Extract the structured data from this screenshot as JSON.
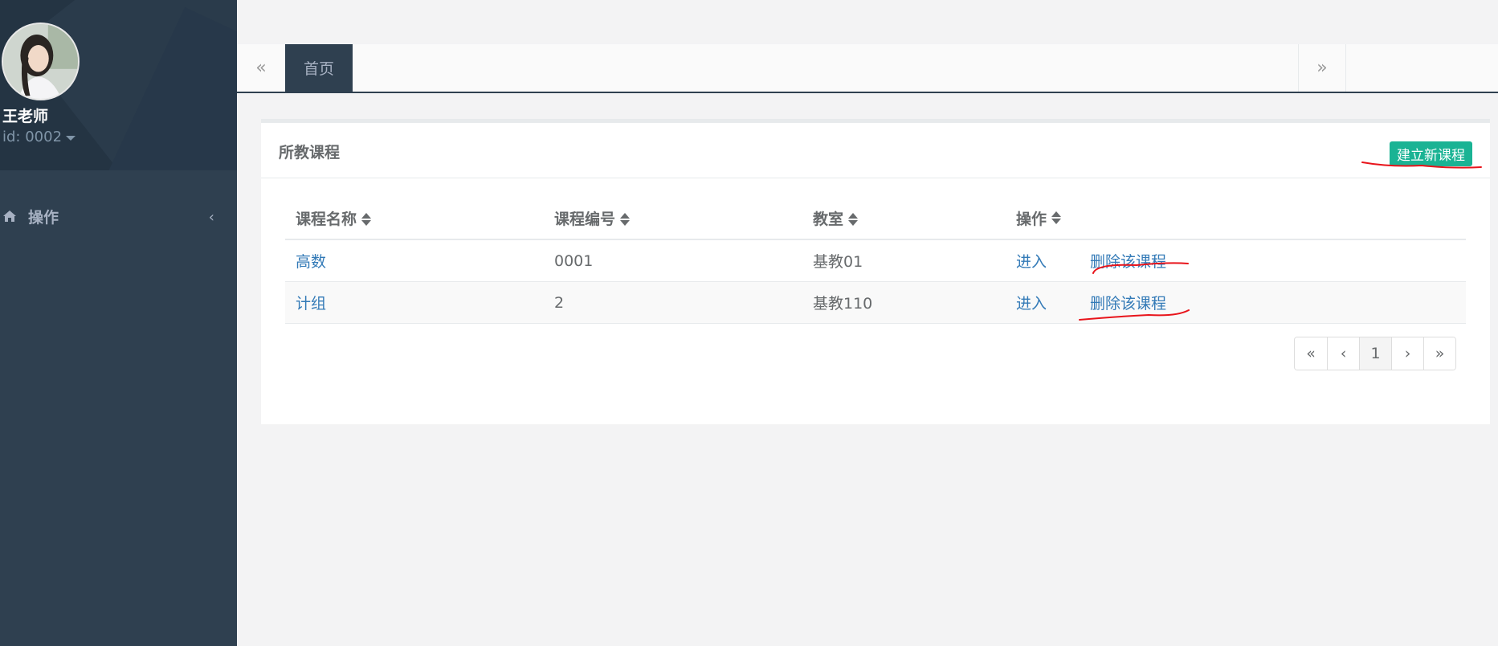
{
  "user": {
    "name": "王老师",
    "id_text": "id: 0002"
  },
  "nav": {
    "item_label": "操作"
  },
  "tabs": {
    "left_arrow": "«",
    "active": "首页",
    "right_arrow": "»"
  },
  "panel": {
    "title": "所教课程",
    "new_button": "建立新课程"
  },
  "table": {
    "headers": [
      "课程名称",
      "课程编号",
      "教室",
      "操作"
    ],
    "rows": [
      {
        "name": "高数",
        "code": "0001",
        "room": "基教01",
        "enter": "进入",
        "delete": "删除该课程"
      },
      {
        "name": "计组",
        "code": "2",
        "room": "基教110",
        "enter": "进入",
        "delete": "删除该课程"
      }
    ]
  },
  "pagination": {
    "first": "«",
    "prev": "‹",
    "page": "1",
    "next": "›",
    "last": "»"
  },
  "colors": {
    "sidebar": "#2f4050",
    "accent": "#1ab394",
    "link": "#337ab7",
    "annotation": "#e8141b"
  },
  "icons": [
    "home-icon",
    "chevron-left-icon",
    "caret-down-icon",
    "sort-icon"
  ]
}
